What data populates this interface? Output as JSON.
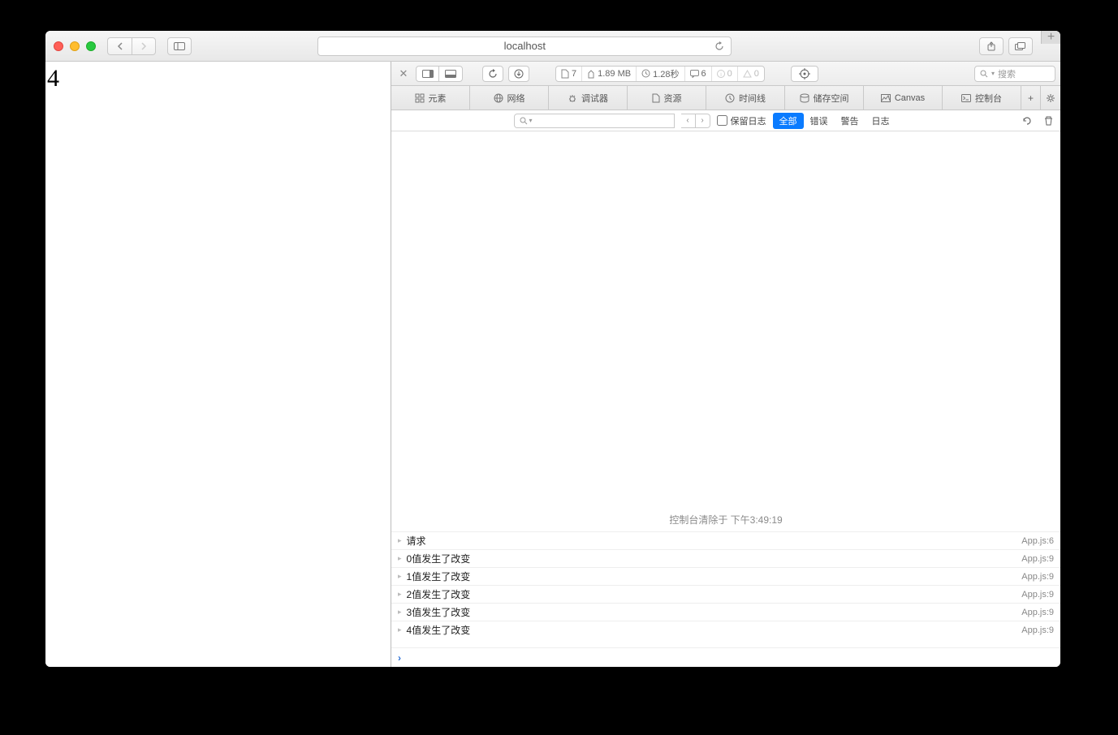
{
  "browser": {
    "url": "localhost",
    "search_placeholder": "搜索"
  },
  "page": {
    "content": "4"
  },
  "devtools": {
    "stats": {
      "docs": "7",
      "size": "1.89 MB",
      "time": "1.28秒",
      "msgs": "6",
      "info": "0",
      "warn": "0"
    },
    "tabs": [
      {
        "id": "elements",
        "label": "元素"
      },
      {
        "id": "network",
        "label": "网络"
      },
      {
        "id": "debugger",
        "label": "调试器"
      },
      {
        "id": "resources",
        "label": "资源"
      },
      {
        "id": "timeline",
        "label": "时间线"
      },
      {
        "id": "storage",
        "label": "储存空间"
      },
      {
        "id": "canvas",
        "label": "Canvas"
      },
      {
        "id": "console",
        "label": "控制台"
      }
    ],
    "filter": {
      "keep_log": "保留日志",
      "levels": {
        "all": "全部",
        "error": "错误",
        "warn": "警告",
        "log": "日志"
      }
    },
    "console": {
      "clear_msg": "控制台清除于 下午3:49:19",
      "rows": [
        {
          "msg": "请求",
          "src": "App.js:6"
        },
        {
          "msg": "0值发生了改变",
          "src": "App.js:9"
        },
        {
          "msg": "1值发生了改变",
          "src": "App.js:9"
        },
        {
          "msg": "2值发生了改变",
          "src": "App.js:9"
        },
        {
          "msg": "3值发生了改变",
          "src": "App.js:9"
        },
        {
          "msg": "4值发生了改变",
          "src": "App.js:9"
        }
      ]
    }
  }
}
